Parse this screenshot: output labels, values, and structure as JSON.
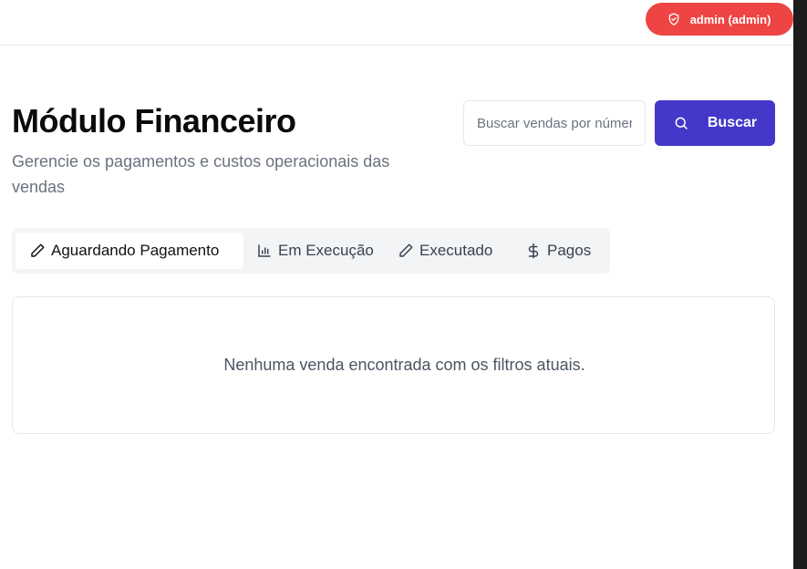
{
  "header": {
    "user_label": "admin (admin)",
    "user_icon": "shield-check-icon",
    "badge_color": "#ef4444"
  },
  "page": {
    "title": "Módulo Financeiro",
    "subtitle": "Gerencie os pagamentos e custos operacionais das vendas"
  },
  "search": {
    "placeholder": "Buscar vendas por número",
    "value": "",
    "button_label": "Buscar",
    "button_icon": "search-icon",
    "button_color": "#4338ca"
  },
  "tabs": [
    {
      "label": "Aguardando Pagamento",
      "icon": "pencil-icon",
      "active": true
    },
    {
      "label": "Em Execução",
      "icon": "bar-chart-icon",
      "active": false
    },
    {
      "label": "Executado",
      "icon": "pencil-icon",
      "active": false
    },
    {
      "label": "Pagos",
      "icon": "dollar-icon",
      "active": false
    }
  ],
  "empty_state": {
    "message": "Nenhuma venda encontrada com os filtros atuais."
  }
}
